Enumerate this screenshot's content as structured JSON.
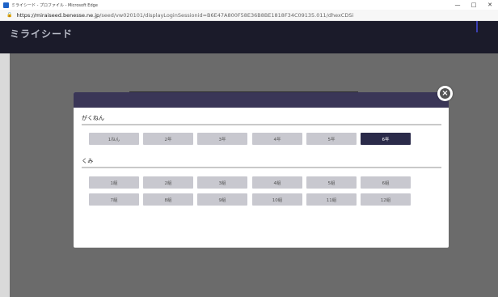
{
  "window": {
    "title": "ミライシード - プロファイル - Microsoft Edge",
    "minimize": "—",
    "maximize": "□",
    "close": "✕"
  },
  "address": {
    "host": "https://miraiseed.benesse.ne.jp",
    "path": "/seed/vw020101/displayLoginSessionid=B6E47A800F58E36B8BE1818F34C09135.011/dhexCDSi"
  },
  "site": {
    "logo": "ミライシード"
  },
  "modal": {
    "close_label": "×",
    "grade_label": "がくねん",
    "class_label": "くみ",
    "grades": [
      "1ねん",
      "2年",
      "3年",
      "4年",
      "5年",
      "6年"
    ],
    "selected_grade": "6年",
    "classes_row1": [
      "1組",
      "2組",
      "3組",
      "4組",
      "5組",
      "6組"
    ],
    "classes_row2": [
      "7組",
      "8組",
      "9組",
      "10組",
      "11組",
      "12組"
    ]
  }
}
